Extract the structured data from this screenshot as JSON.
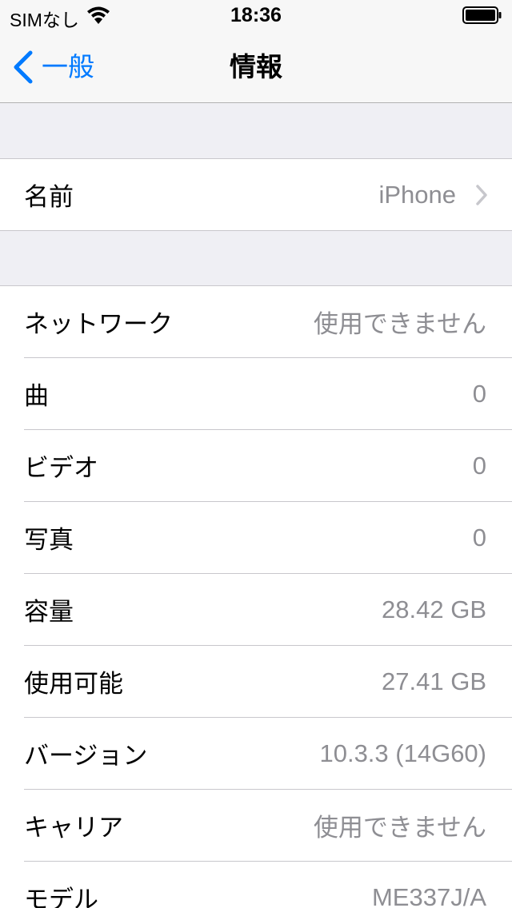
{
  "status_bar": {
    "carrier": "SIMなし",
    "time": "18:36"
  },
  "nav": {
    "back_label": "一般",
    "title": "情報"
  },
  "name_group": {
    "label": "名前",
    "value": "iPhone"
  },
  "info_rows": [
    {
      "label": "ネットワーク",
      "value": "使用できません"
    },
    {
      "label": "曲",
      "value": "0"
    },
    {
      "label": "ビデオ",
      "value": "0"
    },
    {
      "label": "写真",
      "value": "0"
    },
    {
      "label": "容量",
      "value": "28.42 GB"
    },
    {
      "label": "使用可能",
      "value": "27.41 GB"
    },
    {
      "label": "バージョン",
      "value": "10.3.3 (14G60)"
    },
    {
      "label": "キャリア",
      "value": "使用できません"
    },
    {
      "label": "モデル",
      "value": "ME337J/A"
    }
  ],
  "colors": {
    "accent": "#007aff",
    "background": "#efeff4",
    "value_text": "#8e8e93",
    "separator": "#c8c7cc"
  },
  "icons": {
    "wifi": "wifi-icon",
    "battery": "battery-icon",
    "back": "chevron-left-icon",
    "disclosure": "chevron-right-icon"
  }
}
